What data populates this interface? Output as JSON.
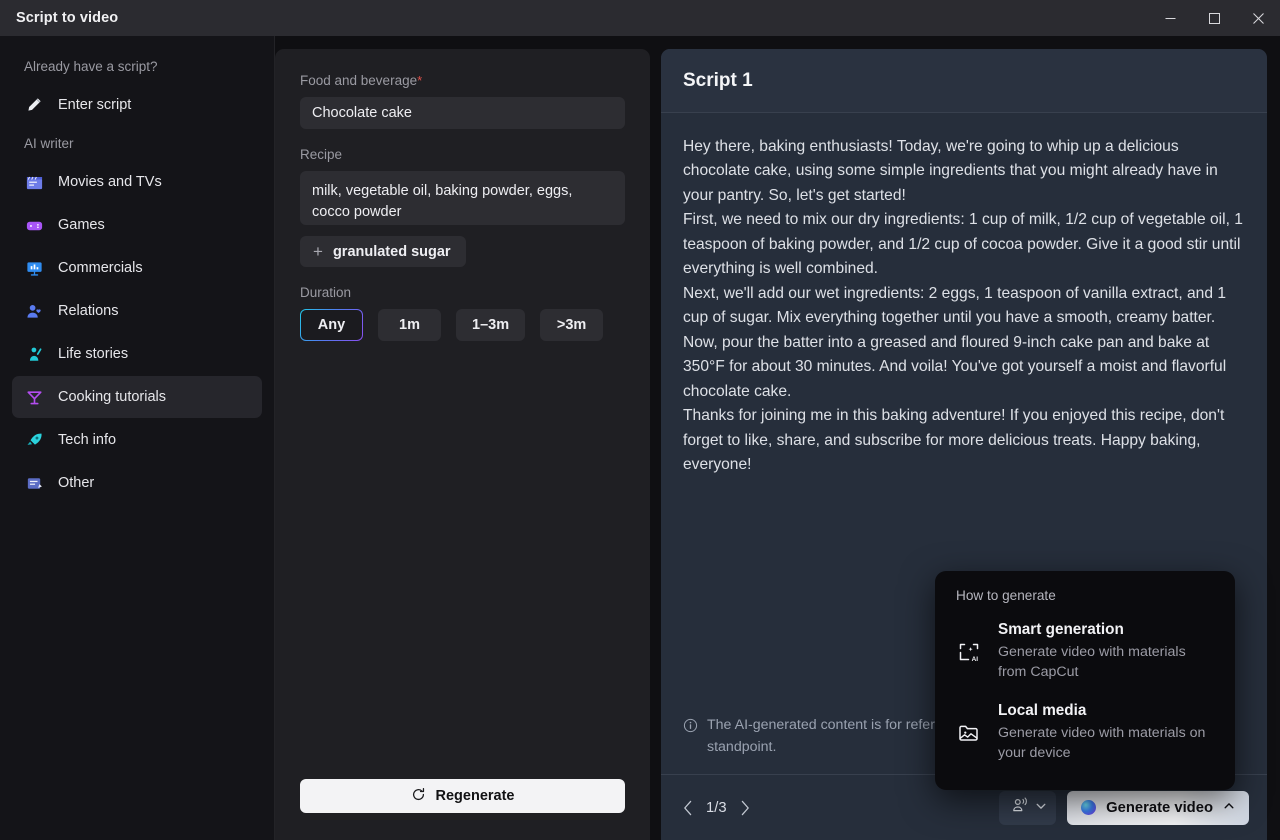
{
  "window": {
    "title": "Script to video",
    "minimize_label": "─",
    "maximize_label": "□",
    "close_label": "✕"
  },
  "sidebar": {
    "section_script": "Already have a script?",
    "script_item": {
      "label": "Enter script",
      "icon": "pencil-icon"
    },
    "section_ai": "AI writer",
    "items": [
      {
        "label": "Movies and TVs",
        "icon": "clapperboard-icon",
        "active": false
      },
      {
        "label": "Games",
        "icon": "gamepad-icon",
        "active": false
      },
      {
        "label": "Commercials",
        "icon": "presentation-icon",
        "active": false
      },
      {
        "label": "Relations",
        "icon": "person-heart-icon",
        "active": false
      },
      {
        "label": "Life stories",
        "icon": "person-wave-icon",
        "active": false
      },
      {
        "label": "Cooking tutorials",
        "icon": "cocktail-icon",
        "active": true
      },
      {
        "label": "Tech info",
        "icon": "rocket-icon",
        "active": false
      },
      {
        "label": "Other",
        "icon": "note-edit-icon",
        "active": false
      }
    ]
  },
  "form": {
    "topic_label": "Food and beverage",
    "topic_required_mark": "*",
    "topic_value": "Chocolate cake",
    "recipe_label": "Recipe",
    "recipe_value": "milk, vegetable oil, baking powder, eggs, cocco powder",
    "add_chip_label": "granulated sugar",
    "add_chip_plus": "+",
    "duration_label": "Duration",
    "duration_options": [
      {
        "label": "Any",
        "selected": true
      },
      {
        "label": "1m",
        "selected": false
      },
      {
        "label": "1–3m",
        "selected": false
      },
      {
        "label": ">3m",
        "selected": false
      }
    ],
    "regenerate_label": "Regenerate"
  },
  "script": {
    "title": "Script 1",
    "paragraphs": [
      "Hey there, baking enthusiasts! Today, we're going to whip up a delicious chocolate cake, using some simple ingredients that you might already have in your pantry. So, let's get started!",
      "First, we need to mix our dry ingredients: 1 cup of milk, 1/2 cup of vegetable oil, 1 teaspoon of baking powder, and 1/2 cup of cocoa powder. Give it a good stir until everything is well combined.",
      "Next, we'll add our wet ingredients: 2 eggs, 1 teaspoon of vanilla extract, and 1 cup of sugar. Mix everything together until you have a smooth, creamy batter.",
      "Now, pour the batter into a greased and floured 9-inch cake pan and bake at 350°F for about 30 minutes. And voila! You've got yourself a moist and flavorful chocolate cake.",
      "Thanks for joining me in this baking adventure! If you enjoyed this recipe, don't forget to like, share, and subscribe for more delicious treats. Happy baking, everyone!"
    ],
    "disclaimer": "The AI-generated content is for reference only and does not represent CapCut’ s standpoint.",
    "page_indicator": "1/3",
    "prev_label": "‹",
    "next_label": "›",
    "voice_icon": "voice-speaker-icon",
    "voice_chevron": "⌄",
    "generate_label": "Generate video",
    "generate_chevron": "˄"
  },
  "popup": {
    "title": "How to generate",
    "items": [
      {
        "title": "Smart generation",
        "desc": "Generate video with materials from CapCut",
        "icon": "ai-frame-icon"
      },
      {
        "title": "Local media",
        "desc": "Generate video with materials on your device",
        "icon": "folder-image-icon"
      }
    ]
  },
  "colors": {
    "titlebar": "#2b2b30",
    "sidebar": "#141418",
    "form_panel": "#1f1f23",
    "script_panel": "#262e3b",
    "accent_required": "#e0514a",
    "selected_border_start": "#22c7e6",
    "selected_border_end": "#8a4ff0"
  }
}
